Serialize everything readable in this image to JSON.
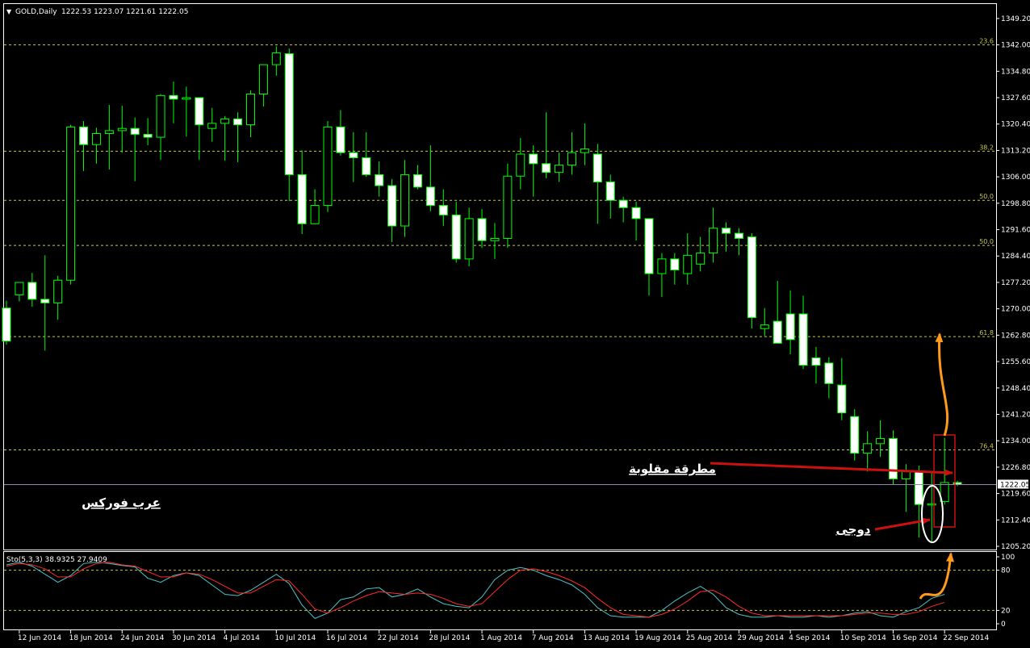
{
  "header": {
    "symbol": "GOLD,Daily",
    "ohlc": "1222.53 1223.07 1221.61 1222.05"
  },
  "stoch_header": "Sto(5,3,3) 38.9325 27.9409",
  "current_price_label": "1222.05",
  "watermark": "عرب فوركس",
  "annotations": {
    "hammer": "مطرقة مقلوبة",
    "doji": "دوجى"
  },
  "colors": {
    "background": "#000000",
    "axis": "#ffffff",
    "bull_body": "#000000",
    "bull_wick": "#00ff00",
    "bear_body": "#ffffff",
    "fib_line": "#c8c84a",
    "stoch_main": "#4fc3c8",
    "stoch_signal": "#ff2a2a",
    "arrow_red": "#cc1010",
    "arrow_orange": "#ff9a1a",
    "ellipse": "#ffffff"
  },
  "chart_data": [
    {
      "type": "candlestick",
      "title": "GOLD,Daily",
      "ylim": [
        1205.2,
        1350.5
      ],
      "y_ticks": [
        1349.2,
        1342.0,
        1334.8,
        1327.6,
        1320.4,
        1313.2,
        1306.0,
        1298.8,
        1291.6,
        1284.4,
        1277.2,
        1270.0,
        1262.8,
        1255.6,
        1248.4,
        1241.2,
        1234.0,
        1226.8,
        1219.6,
        1212.4,
        1205.2
      ],
      "y_tick_labels": [
        "1349.20",
        "1342.00",
        "1334.80",
        "1327.60",
        "1320.40",
        "1313.20",
        "1306.00",
        "1298.80",
        "1291.60",
        "1284.40",
        "1277.20",
        "1270.00",
        "1262.80",
        "1255.60",
        "1248.40",
        "1241.20",
        "1234.00",
        "1226.80",
        "1219.60",
        "1212.40",
        "1205.20"
      ],
      "x_tick_labels": [
        {
          "label": "12 Jun 2014",
          "bar": 1
        },
        {
          "label": "18 Jun 2014",
          "bar": 5
        },
        {
          "label": "24 Jun 2014",
          "bar": 9
        },
        {
          "label": "30 Jun 2014",
          "bar": 13
        },
        {
          "label": "4 Jul 2014",
          "bar": 17
        },
        {
          "label": "10 Jul 2014",
          "bar": 21
        },
        {
          "label": "16 Jul 2014",
          "bar": 25
        },
        {
          "label": "22 Jul 2014",
          "bar": 29
        },
        {
          "label": "28 Jul 2014",
          "bar": 33
        },
        {
          "label": "1 Aug 2014",
          "bar": 37
        },
        {
          "label": "7 Aug 2014",
          "bar": 41
        },
        {
          "label": "13 Aug 2014",
          "bar": 45
        },
        {
          "label": "19 Aug 2014",
          "bar": 49
        },
        {
          "label": "25 Aug 2014",
          "bar": 53
        },
        {
          "label": "29 Aug 2014",
          "bar": 57
        },
        {
          "label": "4 Sep 2014",
          "bar": 61
        },
        {
          "label": "10 Sep 2014",
          "bar": 65
        },
        {
          "label": "16 Sep 2014",
          "bar": 69
        },
        {
          "label": "22 Sep 2014",
          "bar": 73
        }
      ],
      "candles": [
        [
          1270.2,
          1272.2,
          1260.2,
          1261.2
        ],
        [
          1273.8,
          1277.2,
          1272.0,
          1277.2
        ],
        [
          1277.2,
          1279.8,
          1270.6,
          1272.6
        ],
        [
          1272.6,
          1284.6,
          1258.6,
          1271.6
        ],
        [
          1271.6,
          1279.0,
          1267.0,
          1277.8
        ],
        [
          1277.8,
          1320.2,
          1276.6,
          1319.6
        ],
        [
          1319.6,
          1321.2,
          1307.6,
          1314.8
        ],
        [
          1314.8,
          1319.4,
          1309.6,
          1317.8
        ],
        [
          1317.8,
          1325.6,
          1308.0,
          1318.6
        ],
        [
          1318.6,
          1325.4,
          1312.6,
          1319.2
        ],
        [
          1319.2,
          1322.2,
          1304.8,
          1317.6
        ],
        [
          1317.6,
          1322.0,
          1314.6,
          1316.8
        ],
        [
          1316.8,
          1328.6,
          1310.6,
          1328.2
        ],
        [
          1328.2,
          1332.0,
          1320.6,
          1327.2
        ],
        [
          1327.2,
          1330.6,
          1317.0,
          1327.6
        ],
        [
          1327.6,
          1327.6,
          1310.6,
          1320.2
        ],
        [
          1319.2,
          1324.8,
          1315.6,
          1320.6
        ],
        [
          1320.6,
          1322.6,
          1310.4,
          1321.8
        ],
        [
          1321.8,
          1323.6,
          1310.0,
          1320.2
        ],
        [
          1320.2,
          1329.6,
          1316.8,
          1328.6
        ],
        [
          1328.6,
          1336.0,
          1325.2,
          1336.6
        ],
        [
          1336.6,
          1341.6,
          1333.6,
          1339.8
        ],
        [
          1339.6,
          1341.0,
          1299.4,
          1306.6
        ],
        [
          1306.6,
          1313.2,
          1290.4,
          1293.2
        ],
        [
          1293.2,
          1302.6,
          1294.2,
          1298.2
        ],
        [
          1298.2,
          1321.2,
          1296.4,
          1319.6
        ],
        [
          1319.6,
          1324.2,
          1311.8,
          1312.6
        ],
        [
          1312.6,
          1318.2,
          1304.6,
          1311.2
        ],
        [
          1311.2,
          1318.2,
          1306.0,
          1306.6
        ],
        [
          1306.6,
          1310.2,
          1300.6,
          1303.6
        ],
        [
          1303.6,
          1305.4,
          1288.2,
          1292.6
        ],
        [
          1292.6,
          1310.6,
          1289.6,
          1306.6
        ],
        [
          1306.6,
          1309.2,
          1302.6,
          1303.2
        ],
        [
          1303.2,
          1314.6,
          1296.6,
          1298.2
        ],
        [
          1298.2,
          1302.6,
          1292.6,
          1295.6
        ],
        [
          1295.6,
          1299.2,
          1282.6,
          1283.6
        ],
        [
          1283.6,
          1297.6,
          1281.6,
          1294.6
        ],
        [
          1294.6,
          1297.2,
          1286.6,
          1288.6
        ],
        [
          1288.6,
          1293.4,
          1283.6,
          1289.2
        ],
        [
          1289.2,
          1309.6,
          1286.6,
          1306.2
        ],
        [
          1306.2,
          1316.6,
          1302.6,
          1312.2
        ],
        [
          1312.2,
          1314.6,
          1300.6,
          1309.6
        ],
        [
          1309.6,
          1323.6,
          1305.6,
          1307.2
        ],
        [
          1307.2,
          1312.6,
          1304.6,
          1309.2
        ],
        [
          1309.2,
          1318.2,
          1306.6,
          1312.6
        ],
        [
          1312.6,
          1320.6,
          1309.2,
          1313.6
        ],
        [
          1312.2,
          1315.0,
          1293.2,
          1304.6
        ],
        [
          1304.6,
          1306.6,
          1294.6,
          1299.6
        ],
        [
          1299.6,
          1300.6,
          1293.6,
          1297.6
        ],
        [
          1297.6,
          1299.2,
          1288.6,
          1294.6
        ],
        [
          1294.6,
          1294.6,
          1273.6,
          1279.6
        ],
        [
          1279.6,
          1285.2,
          1273.2,
          1283.6
        ],
        [
          1283.6,
          1285.2,
          1276.6,
          1280.6
        ],
        [
          1279.6,
          1290.6,
          1276.6,
          1284.6
        ],
        [
          1282.2,
          1289.6,
          1280.2,
          1285.2
        ],
        [
          1285.2,
          1297.6,
          1282.6,
          1292.0
        ],
        [
          1292.0,
          1293.6,
          1285.6,
          1290.6
        ],
        [
          1290.6,
          1292.0,
          1284.6,
          1289.2
        ],
        [
          1289.6,
          1290.6,
          1264.6,
          1267.6
        ],
        [
          1264.6,
          1270.2,
          1262.6,
          1265.6
        ],
        [
          1266.6,
          1277.6,
          1260.8,
          1260.6
        ],
        [
          1268.6,
          1275.0,
          1257.6,
          1261.6
        ],
        [
          1268.6,
          1273.6,
          1253.6,
          1254.6
        ],
        [
          1256.6,
          1259.6,
          1249.6,
          1254.6
        ],
        [
          1255.2,
          1256.8,
          1245.6,
          1249.6
        ],
        [
          1249.2,
          1256.6,
          1239.6,
          1241.6
        ],
        [
          1240.6,
          1242.6,
          1228.6,
          1230.6
        ],
        [
          1230.6,
          1236.6,
          1225.6,
          1233.2
        ],
        [
          1233.2,
          1239.6,
          1229.6,
          1234.6
        ],
        [
          1234.6,
          1236.8,
          1222.0,
          1223.6
        ],
        [
          1223.6,
          1227.6,
          1214.6,
          1225.6
        ],
        [
          1225.6,
          1227.2,
          1207.6,
          1216.6
        ],
        [
          1216.6,
          1225.6,
          1206.2,
          1216.8
        ],
        [
          1217.4,
          1234.8,
          1216.6,
          1222.6
        ],
        [
          1222.6,
          1223.1,
          1221.6,
          1222.1
        ]
      ],
      "fib_levels": [
        {
          "label": "23.6",
          "price": 1342.0
        },
        {
          "label": "38.2",
          "price": 1313.0
        },
        {
          "label": "50.0",
          "price": 1299.6
        },
        {
          "label": "50.0",
          "price": 1287.3
        },
        {
          "label": "61.8",
          "price": 1262.4
        },
        {
          "label": "76.4",
          "price": 1231.5
        }
      ],
      "current_price": 1222.05
    },
    {
      "type": "line",
      "title": "Sto(5,3,3) 38.9325 27.9409",
      "ylim": [
        0,
        100
      ],
      "y_ticks": [
        100,
        80,
        20,
        0
      ],
      "levels": [
        80,
        20
      ],
      "series": [
        {
          "values": [
            88,
            92,
            86,
            74,
            62,
            72,
            90,
            92,
            90,
            87,
            85,
            68,
            62,
            72,
            76,
            72,
            58,
            44,
            42,
            50,
            62,
            74,
            60,
            28,
            8,
            16,
            36,
            40,
            52,
            54,
            40,
            44,
            52,
            40,
            30,
            26,
            24,
            40,
            66,
            80,
            84,
            80,
            72,
            66,
            58,
            44,
            24,
            12,
            10,
            10,
            10,
            20,
            34,
            46,
            56,
            44,
            24,
            14,
            10,
            10,
            12,
            10,
            10,
            12,
            10,
            12,
            16,
            18,
            12,
            10,
            18,
            24,
            38,
            44
          ]
        },
        {
          "values": [
            86,
            90,
            88,
            82,
            70,
            70,
            82,
            90,
            92,
            88,
            86,
            78,
            70,
            70,
            76,
            74,
            66,
            56,
            46,
            46,
            56,
            66,
            64,
            44,
            22,
            16,
            24,
            34,
            42,
            48,
            46,
            44,
            46,
            44,
            38,
            30,
            26,
            30,
            48,
            66,
            80,
            82,
            78,
            72,
            64,
            54,
            38,
            24,
            14,
            12,
            10,
            14,
            22,
            34,
            48,
            50,
            40,
            26,
            16,
            12,
            12,
            12,
            12,
            12,
            12,
            12,
            14,
            16,
            16,
            14,
            14,
            18,
            26,
            32
          ]
        }
      ]
    }
  ]
}
